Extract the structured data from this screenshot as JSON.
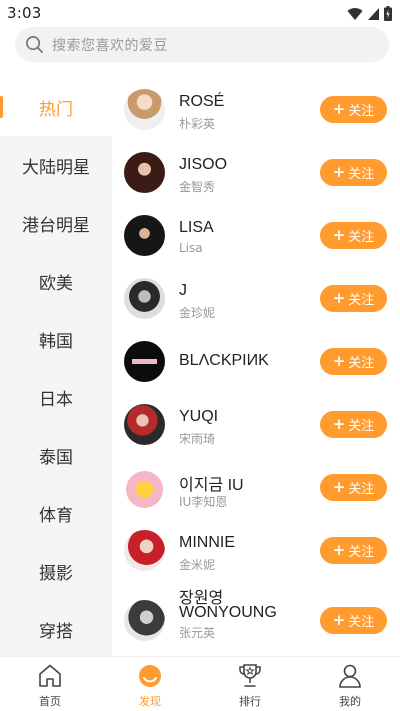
{
  "status_bar": {
    "time": "3:03"
  },
  "search": {
    "placeholder": "搜索您喜欢的爱豆"
  },
  "sidebar": {
    "items": [
      {
        "label": "热门",
        "active": true
      },
      {
        "label": "大陆明星"
      },
      {
        "label": "港台明星"
      },
      {
        "label": "欧美"
      },
      {
        "label": "韩国"
      },
      {
        "label": "日本"
      },
      {
        "label": "泰国"
      },
      {
        "label": "体育"
      },
      {
        "label": "摄影"
      },
      {
        "label": "穿搭"
      }
    ]
  },
  "stars": [
    {
      "name": "ROSÉ",
      "sub": "朴彩英",
      "follow": "关注"
    },
    {
      "name": "JISOO",
      "sub": "金智秀",
      "follow": "关注"
    },
    {
      "name": "LISA",
      "sub": "Lisa",
      "follow": "关注"
    },
    {
      "name": "J",
      "sub": "金珍妮",
      "follow": "关注"
    },
    {
      "name": "BLΛCKPIИK",
      "sub": "",
      "follow": "关注"
    },
    {
      "name": "YUQI",
      "sub": "宋雨琦",
      "follow": "关注"
    },
    {
      "name": "이지금 IU",
      "sub": "IU李知恩",
      "follow": "关注"
    },
    {
      "name": "MINNIE",
      "sub": "金米妮",
      "follow": "关注"
    },
    {
      "name_line1": "장원영",
      "name_line2": "WONYOUNG",
      "sub": "张元英",
      "follow": "关注"
    }
  ],
  "tabbar": {
    "tabs": [
      {
        "label": "首页"
      },
      {
        "label": "发现",
        "active": true
      },
      {
        "label": "排行"
      },
      {
        "label": "我的"
      }
    ]
  },
  "colors": {
    "accent": "#ff9b2f",
    "sidebar_bg": "#f4f5f7",
    "search_bg": "#f1f2f4"
  }
}
